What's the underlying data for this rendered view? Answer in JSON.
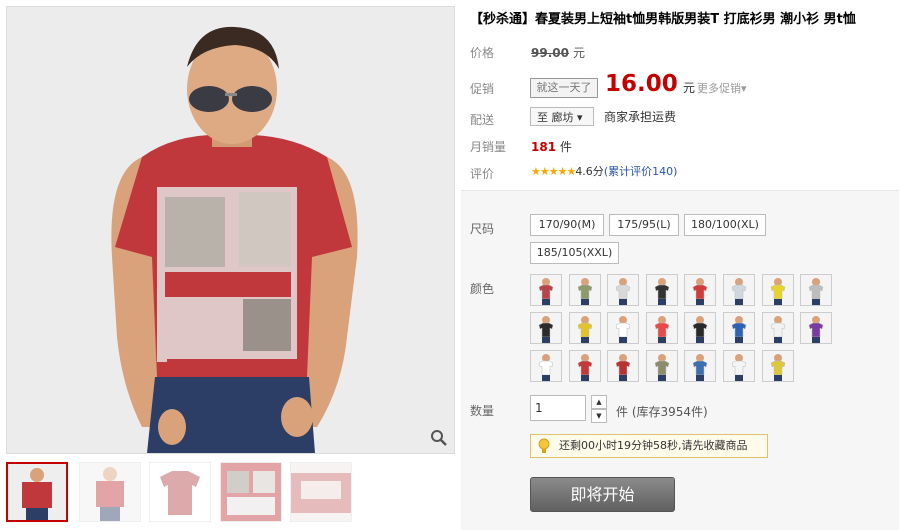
{
  "product": {
    "title": "【秒杀通】春夏装男上短袖t恤男韩版男装T 打底衫男 潮小衫 男t恤"
  },
  "price": {
    "label": "价格",
    "original": "99.00",
    "unit": "元"
  },
  "promo": {
    "label": "促销",
    "badge": "就这一天了",
    "price": "16.00",
    "unit": "元",
    "more": "更多促销▾"
  },
  "shipping": {
    "label": "配送",
    "destination": "至 廊坊 ▾",
    "note": "商家承担运费"
  },
  "sales": {
    "label": "月销量",
    "count": "181",
    "unit": "件"
  },
  "rating": {
    "label": "评价",
    "stars": "★★★★★",
    "score": "4.6分",
    "reviews": "(累计评价140)"
  },
  "sizes": {
    "label": "尺码",
    "options": [
      "170/90(M)",
      "175/95(L)",
      "180/100(XL)",
      "185/105(XXL)"
    ]
  },
  "colors": {
    "label": "颜色",
    "swatches": [
      "#b5454a",
      "#8d9a6c",
      "#d9d9d9",
      "#333333",
      "#d23b3b",
      "#cfd8e0",
      "#e8d32c",
      "#bdbdbd",
      "#2c2c2c",
      "#e2c42a",
      "#ffffff",
      "#e64a4a",
      "#2a2a2a",
      "#2f62b5",
      "#f2f2f2",
      "#7a3aa0",
      "#ffffff",
      "#c43a3a",
      "#b83434",
      "#8c8c6c",
      "#3d6fb0",
      "#f4f4f4",
      "#dcc83a"
    ]
  },
  "quantity": {
    "label": "数量",
    "value": "1",
    "up": "▲",
    "down": "▼",
    "stock": "件 (库存3954件)"
  },
  "notice": {
    "text": "还剩00小时19分钟58秒,请先收藏商品"
  },
  "buy": {
    "label": "即将开始"
  },
  "theme": {
    "accent": "#c40000",
    "link": "#2953a6",
    "star": "#f7a800"
  }
}
